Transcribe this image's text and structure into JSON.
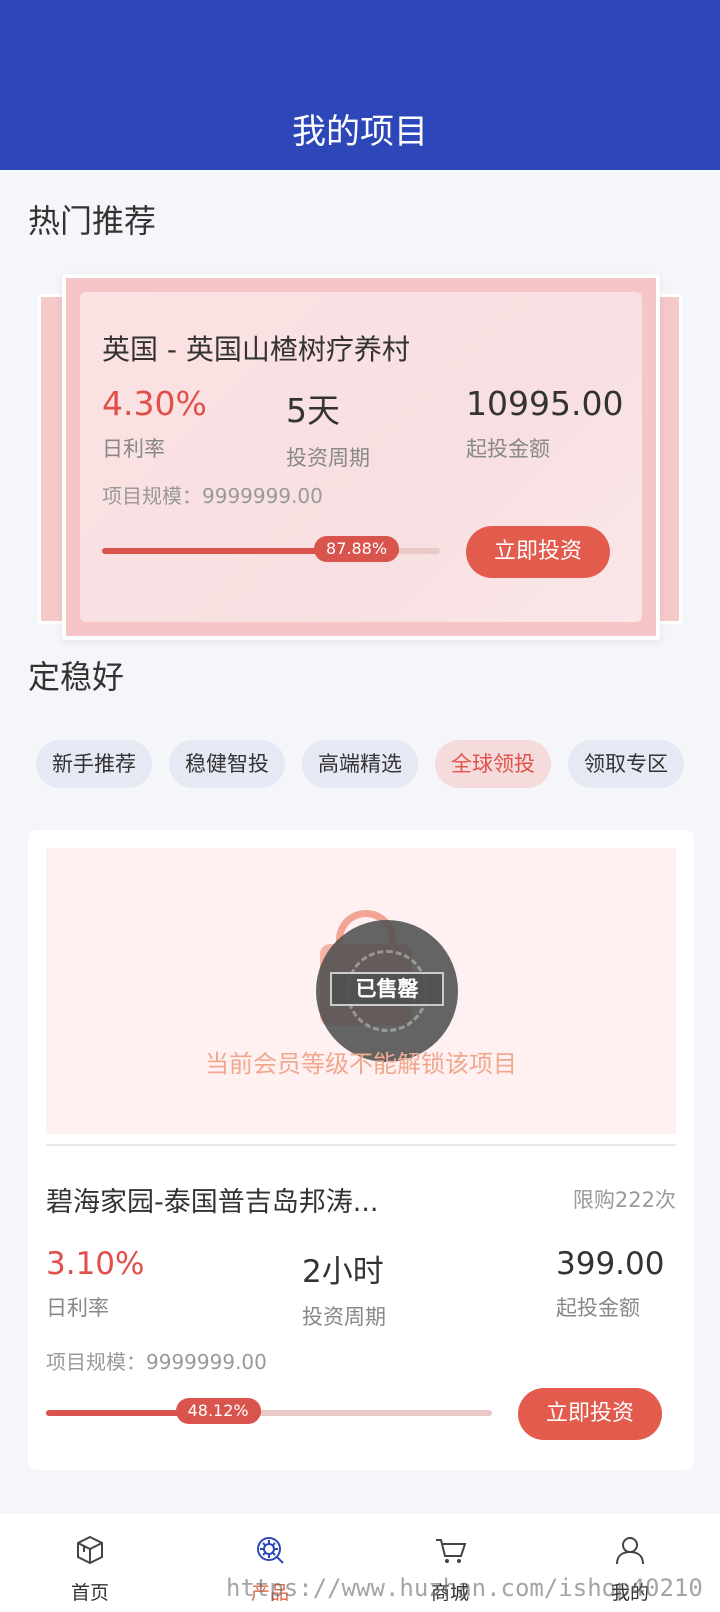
{
  "header": {
    "title": "我的项目"
  },
  "hot": {
    "section_title": "热门推荐",
    "name": "英国 - 英国山楂树疗养村",
    "daily_rate": "4.30%",
    "daily_rate_label": "日利率",
    "period": "5天",
    "period_label": "投资周期",
    "min_amount": "10995.00",
    "min_amount_label": "起投金额",
    "scale_text": "项目规模：9999999.00",
    "progress": 0.8788,
    "progress_text": "87.88%",
    "button": "立即投资"
  },
  "stable": {
    "section_title": "定稳好",
    "tabs": [
      {
        "label": "新手推荐"
      },
      {
        "label": "稳健智投"
      },
      {
        "label": "高端精选"
      },
      {
        "label": "全球领投"
      },
      {
        "label": "领取专区"
      }
    ],
    "active_tab": 3
  },
  "product": {
    "lock_message": "当前会员等级不能解锁该项目",
    "sold_label": "已售罄",
    "name": "碧海家园-泰国普吉岛邦涛...",
    "limit": "限购222次",
    "daily_rate": "3.10%",
    "daily_rate_label": "日利率",
    "period": "2小时",
    "period_label": "投资周期",
    "min_amount": "399.00",
    "min_amount_label": "起投金额",
    "scale_text": "项目规模：9999999.00",
    "progress": 0.4812,
    "progress_text": "48.12%",
    "button": "立即投资"
  },
  "nav": {
    "items": [
      {
        "label": "首页",
        "icon": "home-icon"
      },
      {
        "label": "产品",
        "icon": "product-icon"
      },
      {
        "label": "商城",
        "icon": "cart-icon"
      },
      {
        "label": "我的",
        "icon": "user-icon"
      }
    ],
    "active": 1
  },
  "watermark": "https://www.huzhan.com/ishop40210",
  "colors": {
    "primary": "#2d46b8",
    "accent": "#e25b4d"
  }
}
